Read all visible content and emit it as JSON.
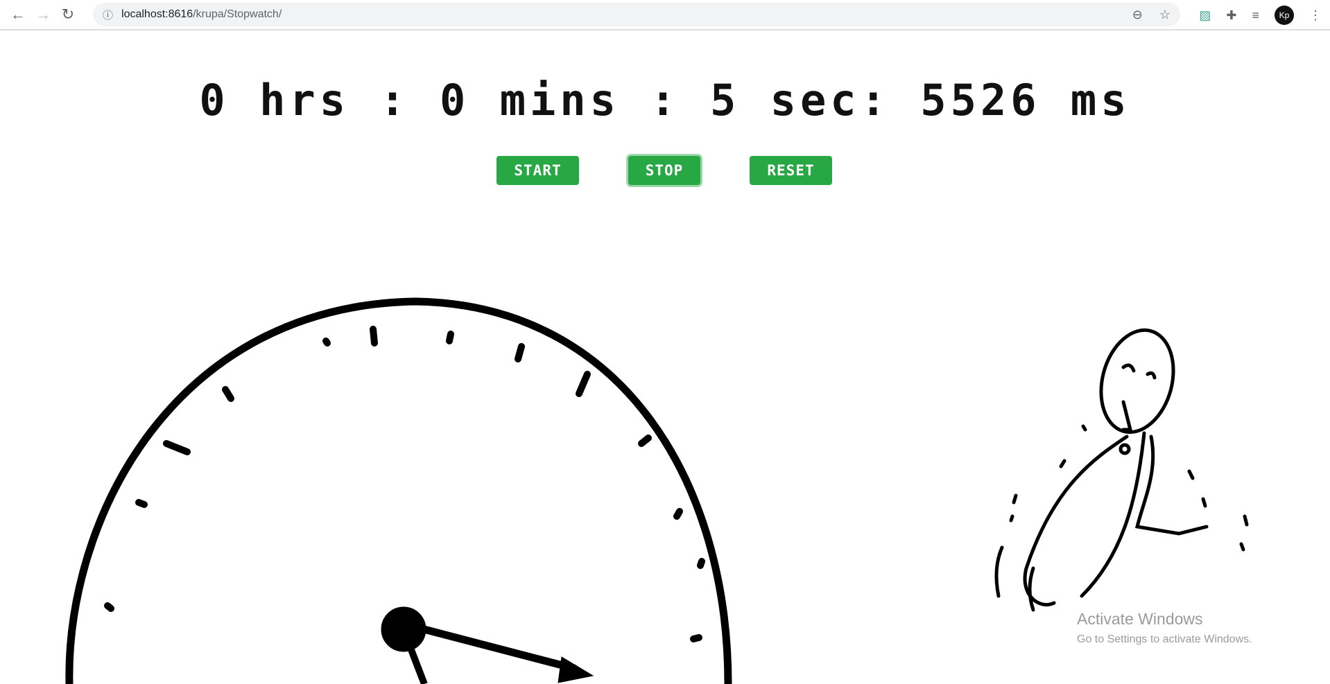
{
  "browser": {
    "url_host": "localhost:8616",
    "url_path": "/krupa/Stopwatch/",
    "avatar": "Kp",
    "icons": [
      "back-icon",
      "forward-icon",
      "reload-icon",
      "info-icon",
      "zoom-icon",
      "star-icon",
      "extension-icon",
      "puzzle-icon",
      "media-icon",
      "menu-icon"
    ]
  },
  "stopwatch": {
    "display": "0 hrs : 0 mins : 5 sec: 5526 ms"
  },
  "buttons": {
    "start": "START",
    "stop": "STOP",
    "reset": "RESET"
  },
  "colors": {
    "button": "#28a745"
  },
  "watermark": {
    "title": "Activate Windows",
    "subtitle": "Go to Settings to activate Windows."
  }
}
